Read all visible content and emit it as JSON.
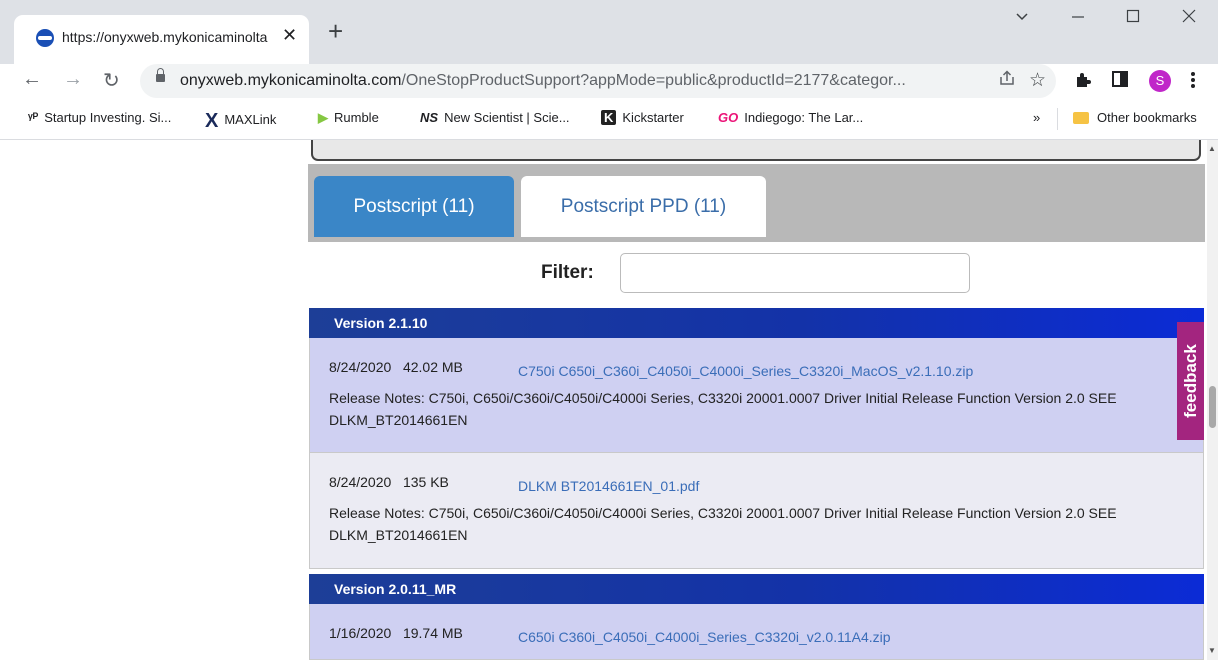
{
  "browser": {
    "tab": {
      "title": "https://onyxweb.mykonicaminolta",
      "close": "✕"
    },
    "new_tab": "+",
    "window_controls": {
      "dropdown": "⌵",
      "minimize": "—",
      "maximize": "☐",
      "close": "✕"
    },
    "nav": {
      "back": "←",
      "forward": "→",
      "reload": "↻"
    },
    "url_domain": "onyxweb.mykonicaminolta.com",
    "url_path": "/OneStopProductSupport?appMode=public&productId=2177&categor...",
    "profile_initial": "S",
    "bookmarks": [
      {
        "icon": "ᵞᴾ",
        "label": "Startup Investing. Si..."
      },
      {
        "icon": "X",
        "label": "MAXLink"
      },
      {
        "icon": "▶",
        "label": "Rumble"
      },
      {
        "icon": "NS",
        "label": "New Scientist | Scie..."
      },
      {
        "icon": "K",
        "label": "Kickstarter"
      },
      {
        "icon": "GO",
        "label": "Indiegogo: The Lar..."
      }
    ],
    "bookmarks_overflow": "»",
    "other_bookmarks": "Other bookmarks",
    "colors": {
      "tabstrip": "#dee1e6",
      "profile": "#c026c9"
    }
  },
  "page": {
    "tabs": [
      {
        "label": "Postscript (11)",
        "active": true
      },
      {
        "label": "Postscript PPD (11)",
        "active": false
      }
    ],
    "filter_label": "Filter:",
    "filter_value": "",
    "feedback": "feedback",
    "versions": [
      {
        "title": "Version 2.1.10",
        "entries": [
          {
            "date": "8/24/2020",
            "size": "42.02 MB",
            "file": "C750i C650i_C360i_C4050i_C4000i_Series_C3320i_MacOS_v2.1.10.zip",
            "notes": "Release Notes: C750i, C650i/C360i/C4050i/C4000i Series, C3320i 20001.0007 Driver Initial Release Function Version 2.0 SEE DLKM_BT2014661EN"
          },
          {
            "date": "8/24/2020",
            "size": "135 KB",
            "file": "DLKM BT2014661EN_01.pdf",
            "notes": "Release Notes: C750i, C650i/C360i/C4050i/C4000i Series, C3320i 20001.0007 Driver Initial Release Function Version 2.0 SEE DLKM_BT2014661EN"
          }
        ]
      },
      {
        "title": "Version 2.0.11_MR",
        "entries": [
          {
            "date": "1/16/2020",
            "size": "19.74 MB",
            "file": "C650i C360i_C4050i_C4000i_Series_C3320i_v2.0.11A4.zip",
            "notes": ""
          }
        ]
      }
    ],
    "colors": {
      "accent": "#3a86c7",
      "link": "#3a6db8",
      "row_highlight": "#cfd0f2",
      "row_plain": "#ebebf3",
      "feedback": "#a3257f"
    }
  }
}
